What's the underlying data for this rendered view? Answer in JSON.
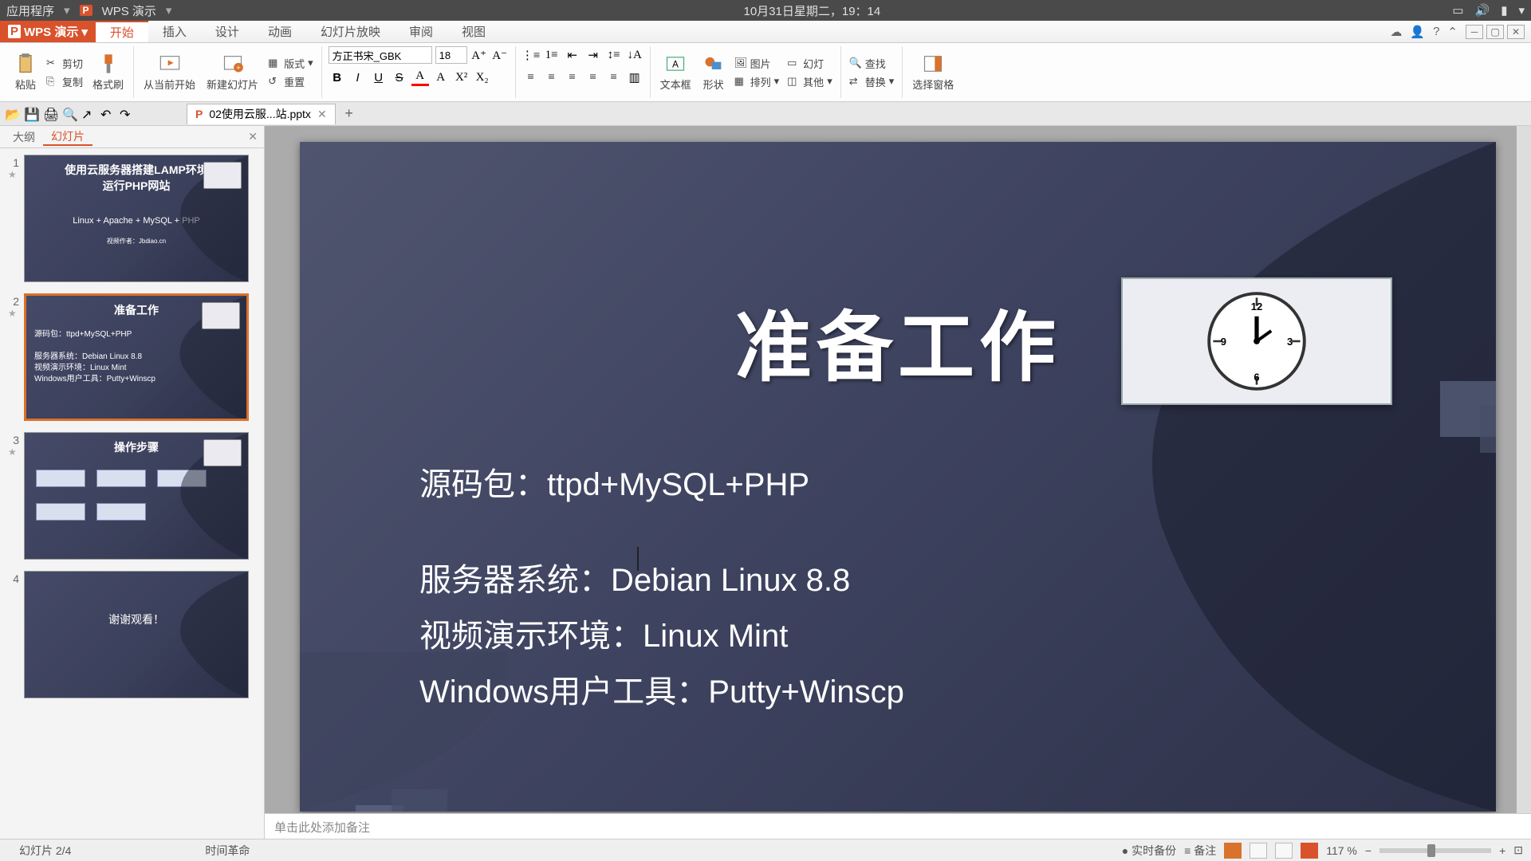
{
  "system": {
    "apps_menu": "应用程序",
    "app_name": "WPS 演示",
    "datetime": "10月31日星期二，19：14"
  },
  "menubar": {
    "logo": "WPS 演示",
    "tabs": [
      "开始",
      "插入",
      "设计",
      "动画",
      "幻灯片放映",
      "审阅",
      "视图"
    ],
    "active_tab_index": 0
  },
  "ribbon": {
    "paste": "粘贴",
    "cut": "剪切",
    "copy": "复制",
    "format_painter": "格式刷",
    "from_current": "从当前开始",
    "new_slide": "新建幻灯片",
    "layout": "版式",
    "reset": "重置",
    "font_name": "方正书宋_GBK",
    "font_size": "18",
    "textbox": "文本框",
    "shape": "形状",
    "arrange": "排列",
    "picture": "图片",
    "ungroup": "其他",
    "slideshow": "幻灯",
    "find": "查找",
    "replace": "替换",
    "select_pane": "选择窗格"
  },
  "qa": {
    "doc_name": "02使用云服...站.pptx"
  },
  "left_panel": {
    "tabs": [
      "大纲",
      "幻灯片"
    ],
    "active_index": 1,
    "thumbs": [
      {
        "title": "使用云服务器搭建LAMP环境\n运行PHP网站",
        "sub": "Linux + Apache + MySQL + PHP",
        "foot": "视频作者：Jbdiao.cn"
      },
      {
        "title": "准备工作",
        "body": "源码包：ttpd+MySQL+PHP\n\n服务器系统：Debian Linux 8.8\n视频演示环境：Linux Mint\nWindows用户工具：Putty+Winscp"
      },
      {
        "title": "操作步骤"
      },
      {
        "title": "谢谢观看！"
      }
    ],
    "active_thumb": 1
  },
  "slide": {
    "title": "准备工作",
    "body1": "源码包：ttpd+MySQL+PHP",
    "body2": "服务器系统：Debian Linux 8.8",
    "body3": "视频演示环境：Linux Mint",
    "body4": "Windows用户工具：Putty+Winscp"
  },
  "notes": {
    "placeholder": "单击此处添加备注"
  },
  "status": {
    "slide_indicator": "幻灯片 2/4",
    "theme": "时间革命",
    "backup": "实时备份",
    "notes_btn": "备注",
    "zoom": "117 %"
  }
}
